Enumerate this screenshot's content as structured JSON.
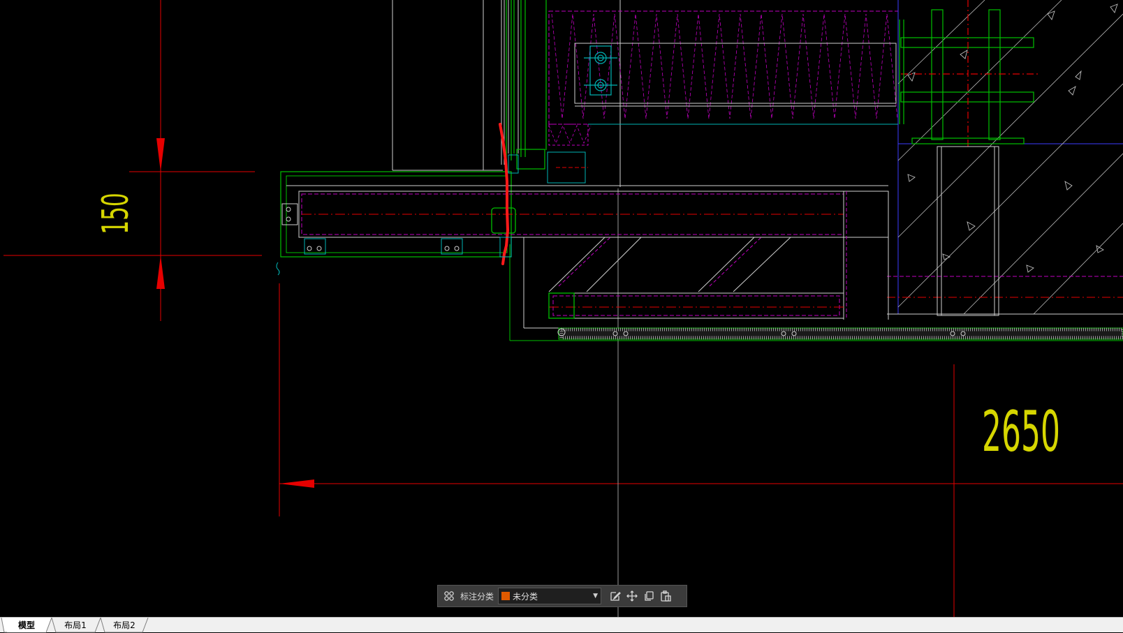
{
  "drawing": {
    "dimensions": [
      {
        "id": "vertical-dimension",
        "value": "150"
      },
      {
        "id": "horizontal-dimension",
        "value": "2650"
      }
    ],
    "colors": {
      "background": "#000000",
      "dimension_line": "#e60000",
      "dimension_text": "#d6d600",
      "frame": "#00c000",
      "insulation": "#c000c0",
      "hatch": "#c8c8c8",
      "markup": "#ff1a1a"
    }
  },
  "annotation_toolbar": {
    "layout_icon": "grid-icon",
    "label": "标注分类",
    "category": {
      "selected": "未分类",
      "swatch_color": "#e05a00"
    },
    "actions": [
      {
        "name": "edit-icon"
      },
      {
        "name": "move-icon"
      },
      {
        "name": "copy-icon"
      },
      {
        "name": "paste-icon"
      }
    ]
  },
  "layout_tabs": [
    {
      "label": "模型",
      "active": true
    },
    {
      "label": "布局1",
      "active": false
    },
    {
      "label": "布局2",
      "active": false
    }
  ]
}
